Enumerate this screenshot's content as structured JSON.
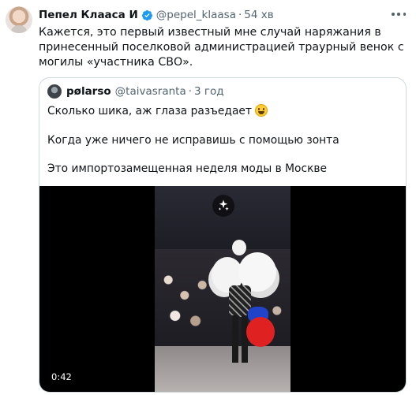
{
  "tweet": {
    "author_name": "Пепел Клааса 📄",
    "author_name_text": "Пепел Клааса",
    "author_badge_glyph": "И",
    "handle": "@pepel_klaasa",
    "separator": "·",
    "time": "54 хв",
    "text": "Кажется, это первый известный мне случай наряжания в принесенный поселковой администрацией траурный венок с могилы «участника СВО».",
    "more_icon": "more-horizontal-icon",
    "verified_icon": "verified-badge-icon"
  },
  "quote": {
    "author_name": "pølarso",
    "handle": "@taivasranta",
    "separator": "·",
    "time": "3 год",
    "line1": "Сколько шика, аж глаза разъедает",
    "line2": "Когда уже ничего не исправишь с помощью зонта",
    "line3": "Это импортозамещенная неделя моды в Москве",
    "emoji": "grinning-face-emoji"
  },
  "media": {
    "duration": "0:42",
    "sparkle_icon": "sparkle-icon"
  },
  "colors": {
    "text_primary": "#0f1419",
    "text_secondary": "#536471",
    "verified_blue": "#1d9bf0",
    "border": "#cfd9de"
  }
}
